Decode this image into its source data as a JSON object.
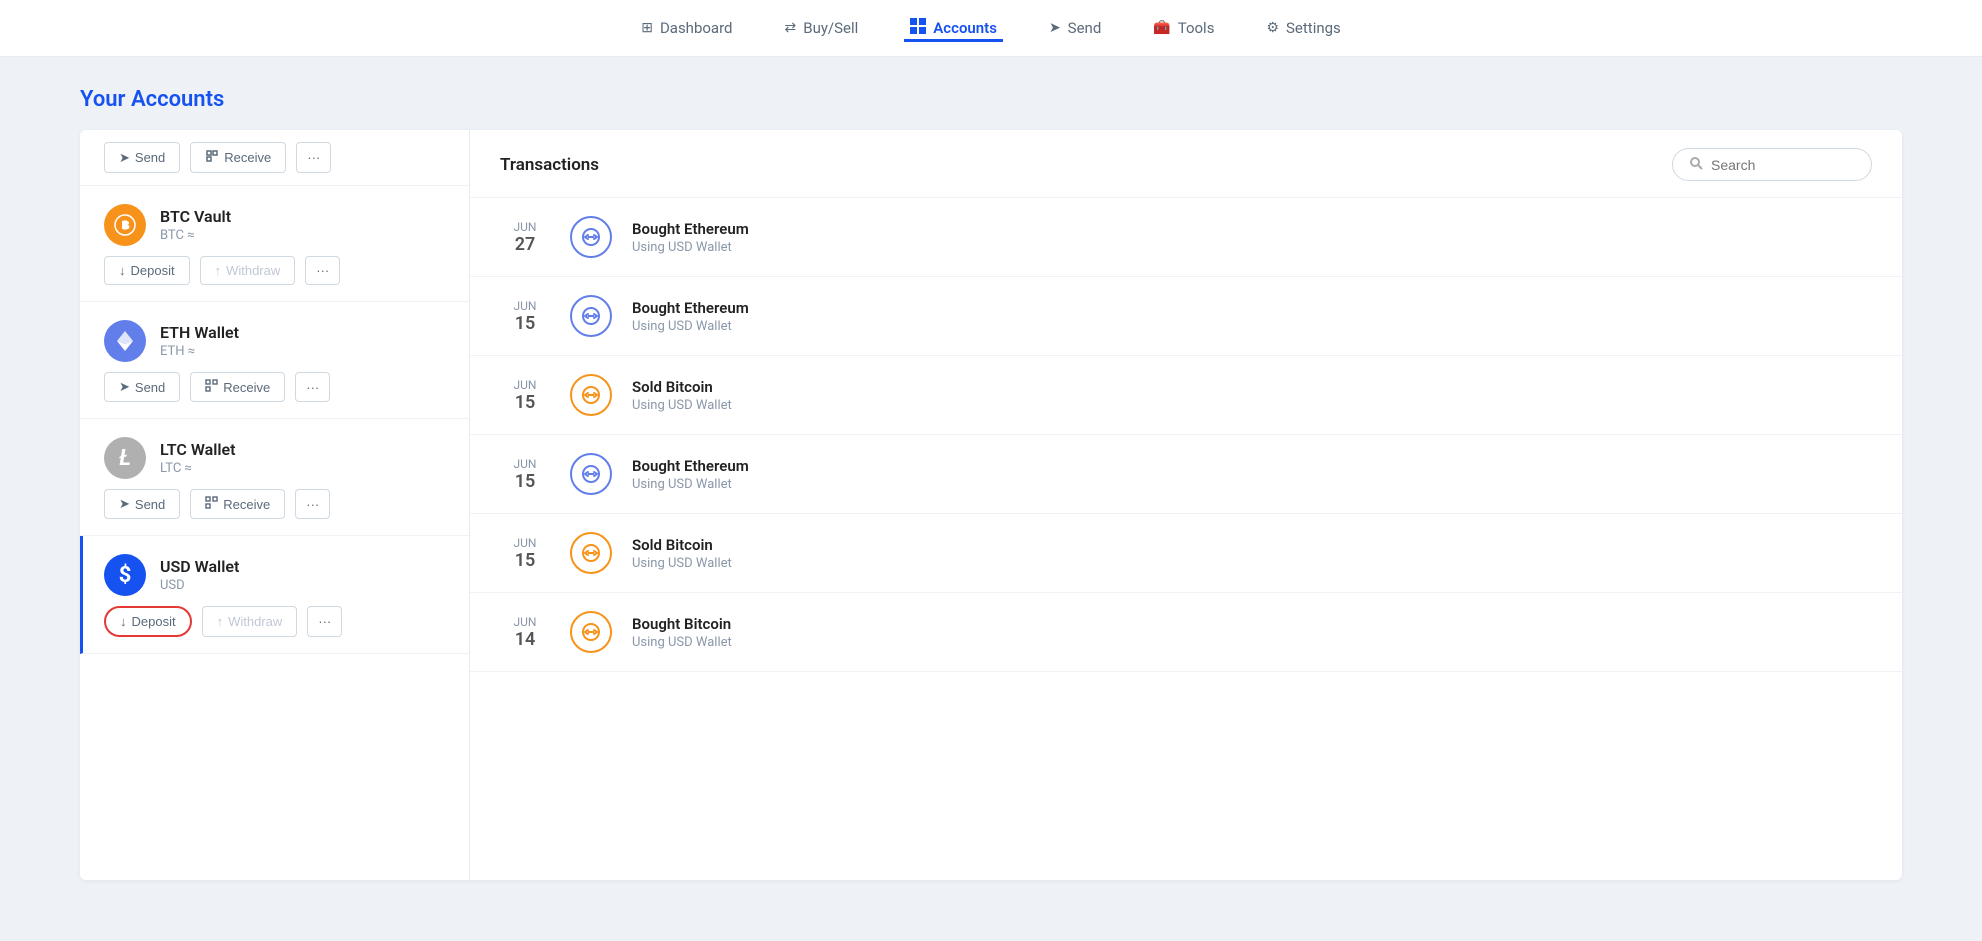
{
  "nav": {
    "items": [
      {
        "id": "dashboard",
        "label": "Dashboard",
        "icon": "⊞",
        "active": false
      },
      {
        "id": "buysell",
        "label": "Buy/Sell",
        "icon": "⇄",
        "active": false
      },
      {
        "id": "accounts",
        "label": "Accounts",
        "icon": "🗂",
        "active": true
      },
      {
        "id": "send",
        "label": "Send",
        "icon": "➤",
        "active": false
      },
      {
        "id": "tools",
        "label": "Tools",
        "icon": "🧰",
        "active": false
      },
      {
        "id": "settings",
        "label": "Settings",
        "icon": "⚙",
        "active": false
      }
    ]
  },
  "page": {
    "title": "Your Accounts"
  },
  "accounts": [
    {
      "id": "btc-vault",
      "name": "BTC Vault",
      "currency": "BTC ≈",
      "type": "btc",
      "logo_symbol": "⚙",
      "actions": [
        "Deposit",
        "Withdraw",
        "..."
      ],
      "active": false,
      "show_top_actions": true,
      "top_actions": [
        "Send",
        "Receive",
        "..."
      ]
    },
    {
      "id": "eth-wallet",
      "name": "ETH Wallet",
      "currency": "ETH ≈",
      "type": "eth",
      "logo_symbol": "◆",
      "actions": [
        "Send",
        "Receive",
        "..."
      ],
      "active": false
    },
    {
      "id": "ltc-wallet",
      "name": "LTC Wallet",
      "currency": "LTC ≈",
      "type": "ltc",
      "logo_symbol": "Ł",
      "actions": [
        "Send",
        "Receive",
        "..."
      ],
      "active": false
    },
    {
      "id": "usd-wallet",
      "name": "USD Wallet",
      "currency": "USD",
      "type": "usd",
      "logo_symbol": "$",
      "actions": [
        "Deposit",
        "Withdraw",
        "..."
      ],
      "active": true,
      "deposit_highlighted": true
    }
  ],
  "transactions": {
    "title": "Transactions",
    "search_placeholder": "Search",
    "items": [
      {
        "id": "tx1",
        "month": "JUN",
        "day": "27",
        "name": "Bought Ethereum",
        "sub": "Using USD Wallet",
        "icon_type": "blue-border",
        "icon": "⇄"
      },
      {
        "id": "tx2",
        "month": "JUN",
        "day": "15",
        "name": "Bought Ethereum",
        "sub": "Using USD Wallet",
        "icon_type": "blue-border",
        "icon": "⇄"
      },
      {
        "id": "tx3",
        "month": "JUN",
        "day": "15",
        "name": "Sold Bitcoin",
        "sub": "Using USD Wallet",
        "icon_type": "gold-border",
        "icon": "⇄"
      },
      {
        "id": "tx4",
        "month": "JUN",
        "day": "15",
        "name": "Bought Ethereum",
        "sub": "Using USD Wallet",
        "icon_type": "blue-border",
        "icon": "⇄"
      },
      {
        "id": "tx5",
        "month": "JUN",
        "day": "15",
        "name": "Sold Bitcoin",
        "sub": "Using USD Wallet",
        "icon_type": "gold-border",
        "icon": "⇄"
      },
      {
        "id": "tx6",
        "month": "JUN",
        "day": "14",
        "name": "Bought Bitcoin",
        "sub": "Using USD Wallet",
        "icon_type": "gold-border",
        "icon": "⇄"
      }
    ]
  }
}
